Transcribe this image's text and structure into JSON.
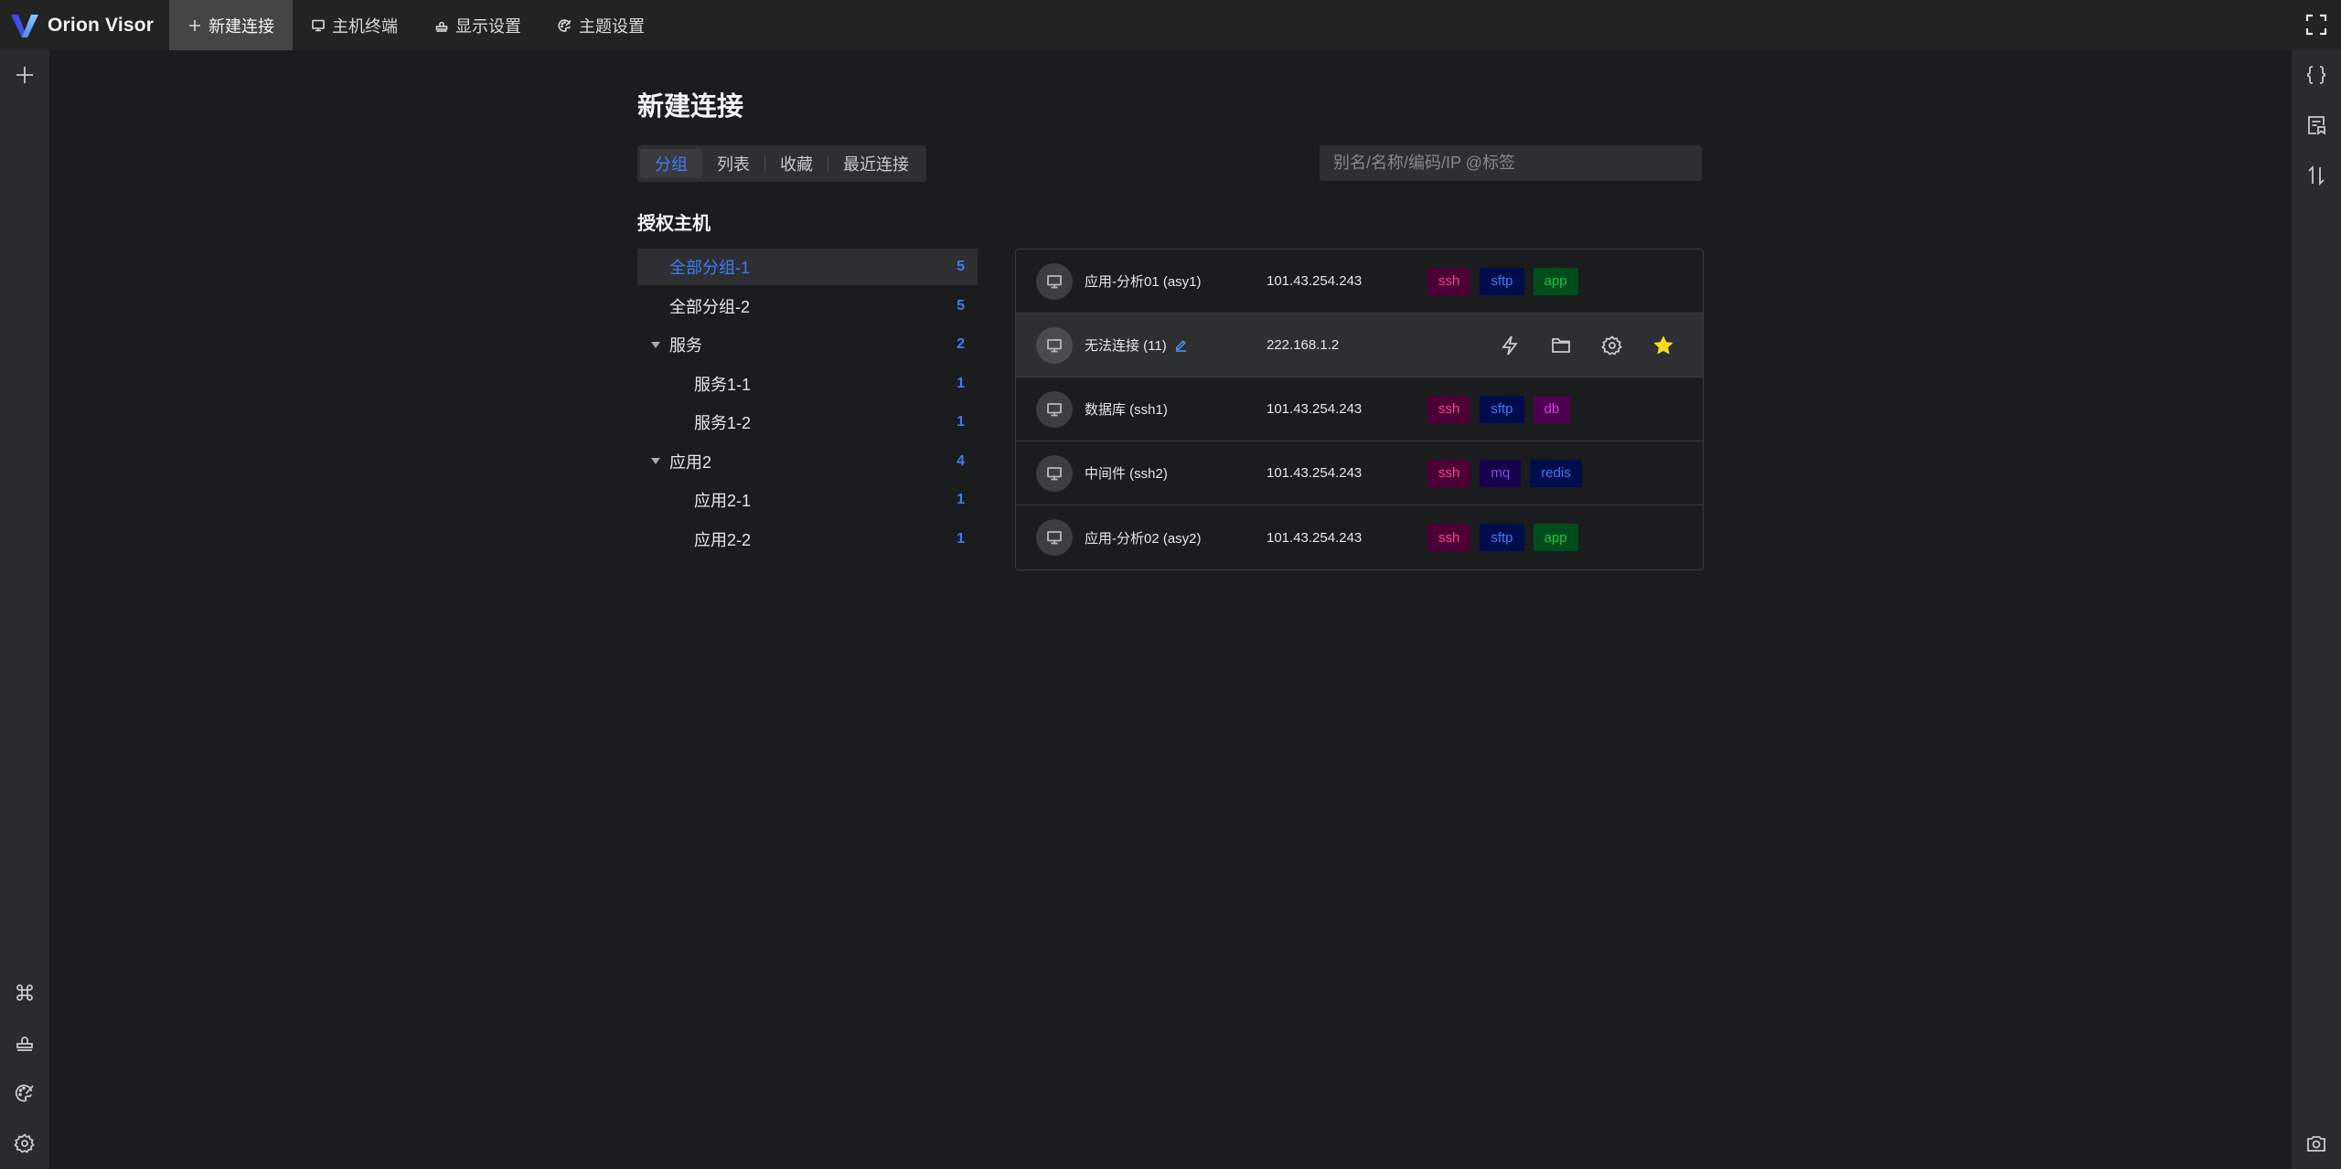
{
  "app": {
    "title": "Orion Visor"
  },
  "top_tabs": [
    {
      "label": "新建连接",
      "icon": "plus-icon",
      "active": true
    },
    {
      "label": "主机终端",
      "icon": "monitor-icon",
      "active": false
    },
    {
      "label": "显示设置",
      "icon": "stamp-icon",
      "active": false
    },
    {
      "label": "主题设置",
      "icon": "palette-icon",
      "active": false
    }
  ],
  "left_sidebar": {
    "top": [
      {
        "icon": "plus-icon",
        "label": "new"
      }
    ],
    "bottom": [
      {
        "icon": "command-icon"
      },
      {
        "icon": "stamp-icon"
      },
      {
        "icon": "palette-icon"
      },
      {
        "icon": "gear-icon"
      }
    ]
  },
  "right_sidebar": {
    "items": [
      {
        "icon": "braces-icon"
      },
      {
        "icon": "snippet-icon"
      },
      {
        "icon": "transfer-icon"
      }
    ],
    "bottom": [
      {
        "icon": "camera-icon"
      }
    ]
  },
  "page": {
    "title": "新建连接",
    "view_tabs": [
      {
        "label": "分组",
        "active": true
      },
      {
        "label": "列表",
        "active": false
      },
      {
        "label": "收藏",
        "active": false
      },
      {
        "label": "最近连接",
        "active": false
      }
    ],
    "search": {
      "placeholder": "别名/名称/编码/IP @标签",
      "value": ""
    },
    "section_title": "授权主机"
  },
  "tree": [
    {
      "label": "全部分组-1",
      "count": "5",
      "level": 0,
      "expandable": false,
      "selected": true
    },
    {
      "label": "全部分组-2",
      "count": "5",
      "level": 0,
      "expandable": false,
      "selected": false
    },
    {
      "label": "服务",
      "count": "2",
      "level": 0,
      "expandable": true,
      "selected": false
    },
    {
      "label": "服务1-1",
      "count": "1",
      "level": 1,
      "expandable": false,
      "selected": false
    },
    {
      "label": "服务1-2",
      "count": "1",
      "level": 1,
      "expandable": false,
      "selected": false
    },
    {
      "label": "应用2",
      "count": "4",
      "level": 0,
      "expandable": true,
      "selected": false
    },
    {
      "label": "应用2-1",
      "count": "1",
      "level": 1,
      "expandable": false,
      "selected": false
    },
    {
      "label": "应用2-2",
      "count": "1",
      "level": 1,
      "expandable": false,
      "selected": false
    }
  ],
  "hosts": [
    {
      "name": "应用-分析01 (asy1)",
      "ip": "101.43.254.243",
      "tags": [
        "ssh",
        "sftp",
        "app"
      ],
      "hover": false
    },
    {
      "name": "无法连接 (11)",
      "ip": "222.168.1.2",
      "tags": [],
      "hover": true,
      "editable": true,
      "favorite": true
    },
    {
      "name": "数据库 (ssh1)",
      "ip": "101.43.254.243",
      "tags": [
        "ssh",
        "sftp",
        "db"
      ],
      "hover": false
    },
    {
      "name": "中间件 (ssh2)",
      "ip": "101.43.254.243",
      "tags": [
        "ssh",
        "mq",
        "redis"
      ],
      "hover": false
    },
    {
      "name": "应用-分析02 (asy2)",
      "ip": "101.43.254.243",
      "tags": [
        "ssh",
        "sftp",
        "app"
      ],
      "hover": false
    }
  ],
  "host_actions": [
    {
      "icon": "lightning-icon",
      "label": "connect"
    },
    {
      "icon": "folder-icon",
      "label": "sftp"
    },
    {
      "icon": "gear-icon",
      "label": "settings"
    },
    {
      "icon": "star-icon",
      "label": "favorite"
    }
  ],
  "tag_colors": {
    "ssh": {
      "bg": "#4d0036",
      "fg": "#f5468f"
    },
    "sftp": {
      "bg": "#000d4d",
      "fg": "#3f7cf0"
    },
    "app": {
      "bg": "#004d1c",
      "fg": "#27c346"
    },
    "db": {
      "bg": "#4d0050",
      "fg": "#d33fe0"
    },
    "mq": {
      "bg": "#16004d",
      "fg": "#8d4eda"
    },
    "redis": {
      "bg": "#000d4d",
      "fg": "#3f7cf0"
    }
  },
  "colors": {
    "accent": "#3f7cf0",
    "favorite": "#fadc19",
    "background": "#1b1c1e",
    "topbar": "#232324",
    "sidebar": "#2a2b2e"
  }
}
